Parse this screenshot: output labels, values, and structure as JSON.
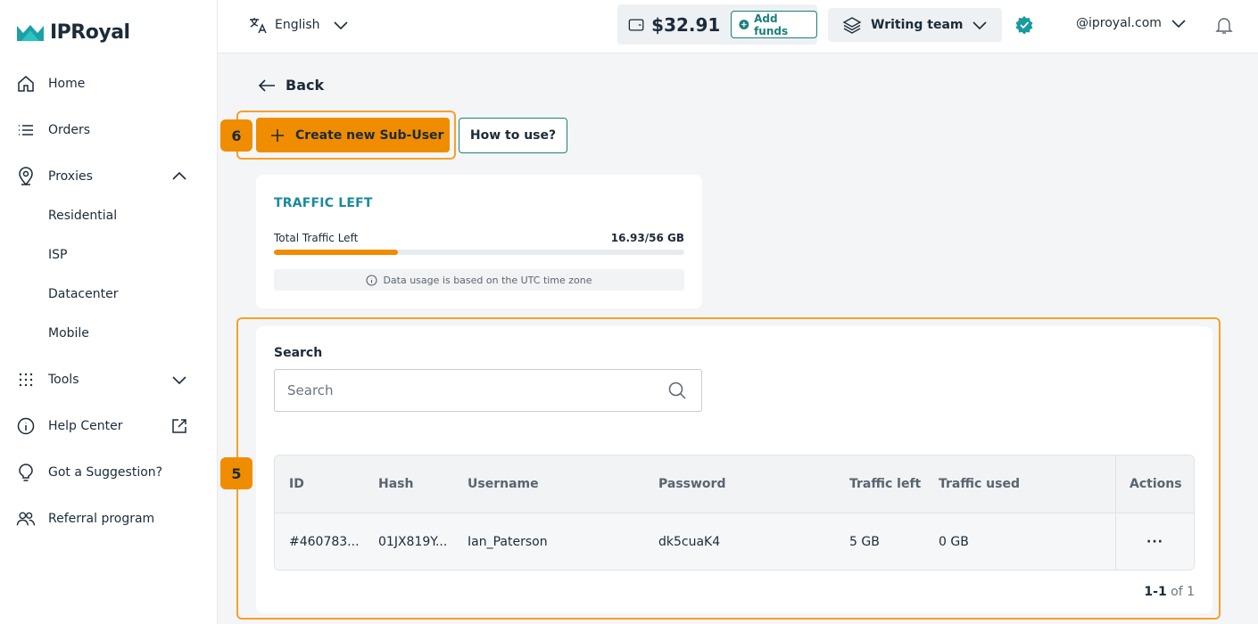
{
  "brand": {
    "name": "IPRoyal",
    "accent": "#f08c00",
    "teal": "#1a7f7c"
  },
  "sidebar": {
    "items": [
      {
        "label": "Home",
        "icon": "home-icon"
      },
      {
        "label": "Orders",
        "icon": "list-icon"
      },
      {
        "label": "Proxies",
        "icon": "location-pin-icon"
      },
      {
        "label": "Tools",
        "icon": "grid-dots-icon"
      },
      {
        "label": "Help Center",
        "icon": "info-icon"
      },
      {
        "label": "Got a Suggestion?",
        "icon": "lightbulb-icon"
      },
      {
        "label": "Referral program",
        "icon": "users-icon"
      }
    ],
    "proxies_sub": [
      "Residential",
      "ISP",
      "Datacenter",
      "Mobile"
    ]
  },
  "topbar": {
    "language": "English",
    "balance": "$32.91",
    "add_funds": "Add funds",
    "team": "Writing team",
    "account": "@iproyal.com"
  },
  "main": {
    "back": "Back",
    "create_button": "Create new Sub-User",
    "how_button": "How to use?",
    "badge_create": "6",
    "badge_table": "5"
  },
  "traffic": {
    "title": "TRAFFIC LEFT",
    "label": "Total Traffic Left",
    "value": "16.93/56 GB",
    "fraction_left": 0.302,
    "note": "Data usage is based on the UTC time zone"
  },
  "users": {
    "search_label": "Search",
    "search_placeholder": "Search",
    "columns": [
      "ID",
      "Hash",
      "Username",
      "Password",
      "Traffic left",
      "Traffic used",
      "Actions"
    ],
    "rows": [
      {
        "id": "#460783...",
        "hash": "01JX819Y...",
        "username": "Ian_Paterson",
        "password": "dk5cuaK4",
        "traffic_left": "5 GB",
        "traffic_used": "0 GB",
        "actions": "···"
      }
    ],
    "pager_range": "1-1",
    "pager_of": "of 1"
  }
}
